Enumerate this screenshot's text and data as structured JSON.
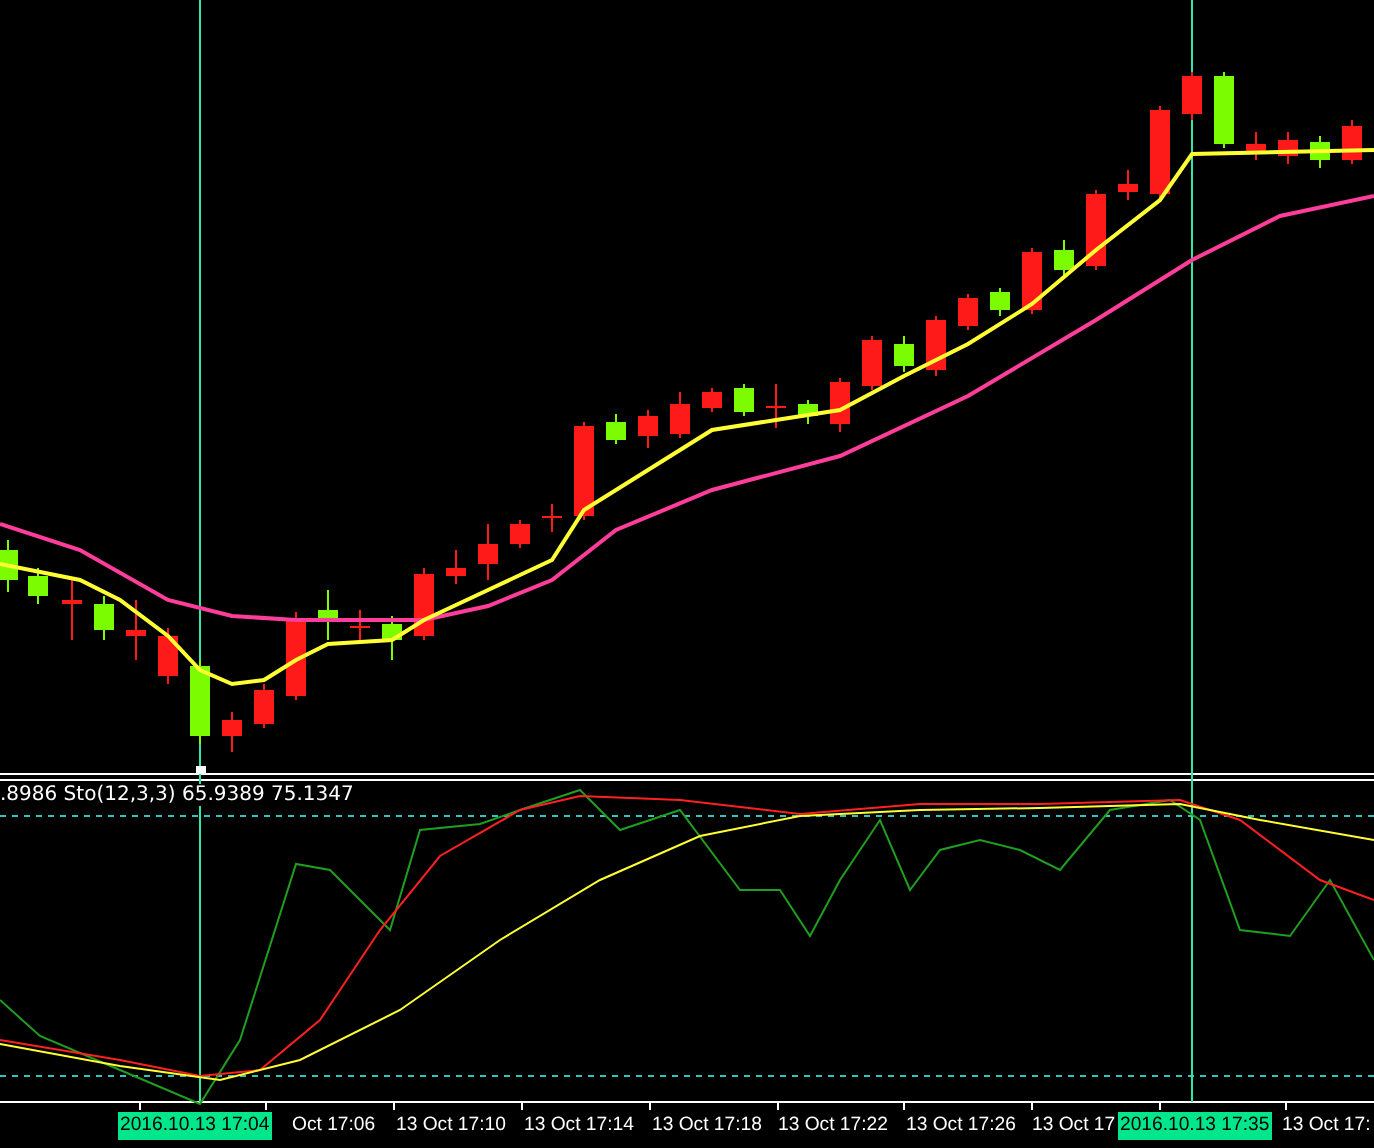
{
  "indicator_label": ".8986  Sto(12,3,3) 65.9389 75.1347",
  "time_axis": [
    {
      "label": "2016.10.13 17:04",
      "kind": "cursor"
    },
    {
      "label": "Oct 17:06",
      "kind": "tick"
    },
    {
      "label": "13 Oct 17:10",
      "kind": "tick"
    },
    {
      "label": "13 Oct 17:14",
      "kind": "tick"
    },
    {
      "label": "13 Oct 17:18",
      "kind": "tick"
    },
    {
      "label": "13 Oct 17:22",
      "kind": "tick"
    },
    {
      "label": "13 Oct 17:26",
      "kind": "tick"
    },
    {
      "label": "13 Oct 17",
      "kind": "tick"
    },
    {
      "label": "2016.10.13 17:35",
      "kind": "cursor"
    },
    {
      "label": "13 Oct 17:",
      "kind": "tick"
    }
  ]
}
